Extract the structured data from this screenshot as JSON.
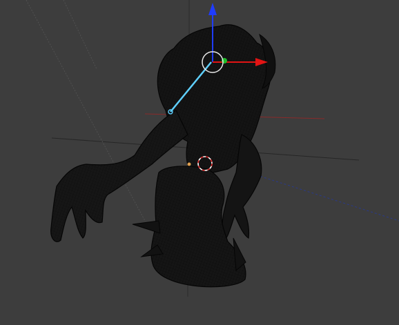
{
  "viewport": {
    "background": "#3d3d3d",
    "grid_color": "#2b2b2b",
    "x_axis_color": "#8a2a2a",
    "y_axis_color": "#2a3a8a",
    "mesh_fill": "#141414",
    "mesh_wire": "#050505"
  },
  "gizmo": {
    "z_axis_color": "#1f3cff",
    "x_axis_color": "#e31414",
    "y_axis_color": "#1fbf2a",
    "ring_color": "#e8e8e8",
    "bone_color": "#5fd0ff"
  },
  "cursor_3d": {
    "outer_color": "#ffffff",
    "inner_color": "#d02020"
  }
}
